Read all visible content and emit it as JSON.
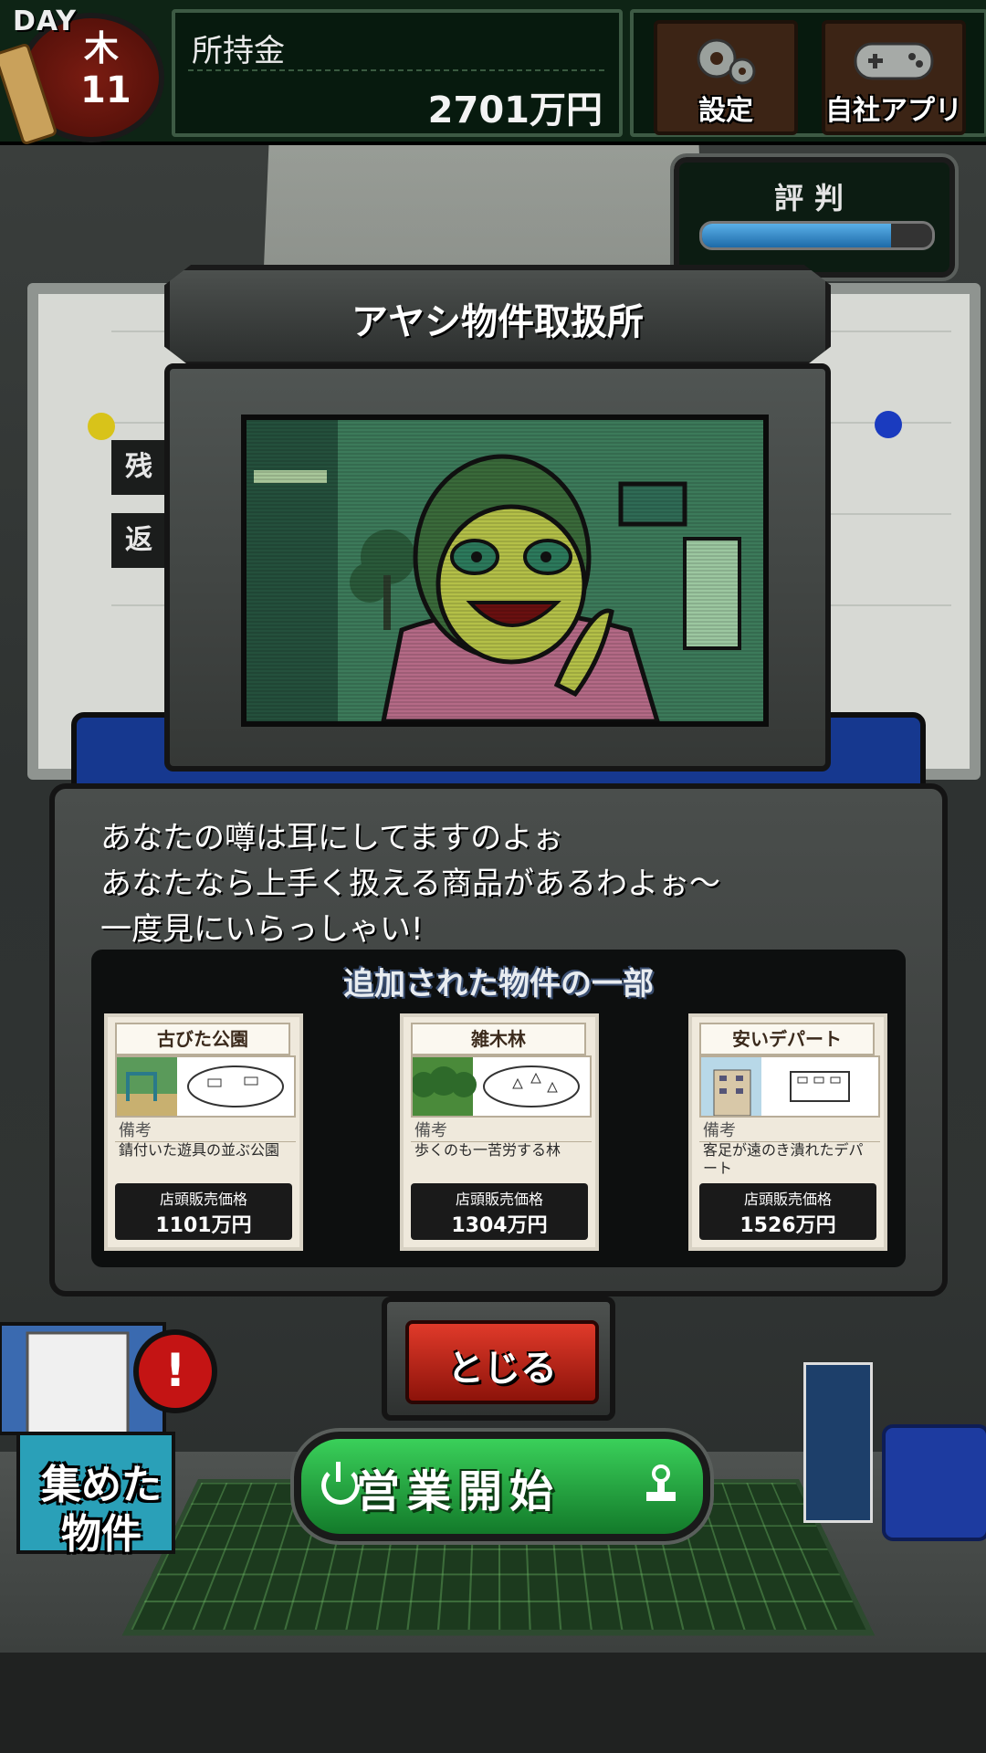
{
  "hud": {
    "day_label": "DAY",
    "weekday": "木",
    "day_number": "11",
    "money_label": "所持金",
    "money_value": "2701万円",
    "settings_label": "設定",
    "apps_label": "自社アプリ",
    "reputation_label": "評判",
    "reputation_level": 0.82
  },
  "dialog": {
    "title": "アヤシ物件取扱所",
    "message_lines": [
      "あなたの噂は耳にしてますのよぉ",
      "あなたなら上手く扱える商品があるわよぉ～",
      "一度見にいらっしゃい!"
    ],
    "list_title": "追加された物件の一部",
    "note_label": "備考",
    "price_label": "店頭販売価格",
    "properties": [
      {
        "name": "古びた公園",
        "note": "錆付いた遊具の並ぶ公園",
        "price": "1101万円"
      },
      {
        "name": "雑木林",
        "note": "歩くのも一苦労する林",
        "price": "1304万円"
      },
      {
        "name": "安いデパート",
        "note": "客足が遠のき潰れたデパート",
        "price": "1526万円"
      }
    ],
    "close_label": "とじる"
  },
  "desk": {
    "start_label": "営業開始",
    "collected_label_1": "集めた",
    "collected_label_2": "物件",
    "alert_mark": "!"
  },
  "background": {
    "board_tag_1": "残",
    "board_tag_2": "返"
  },
  "colors": {
    "topbar": "#0e2415",
    "accent_red": "#c41414",
    "start_green": "#2bb848",
    "rep_blue": "#1d6aa8"
  }
}
